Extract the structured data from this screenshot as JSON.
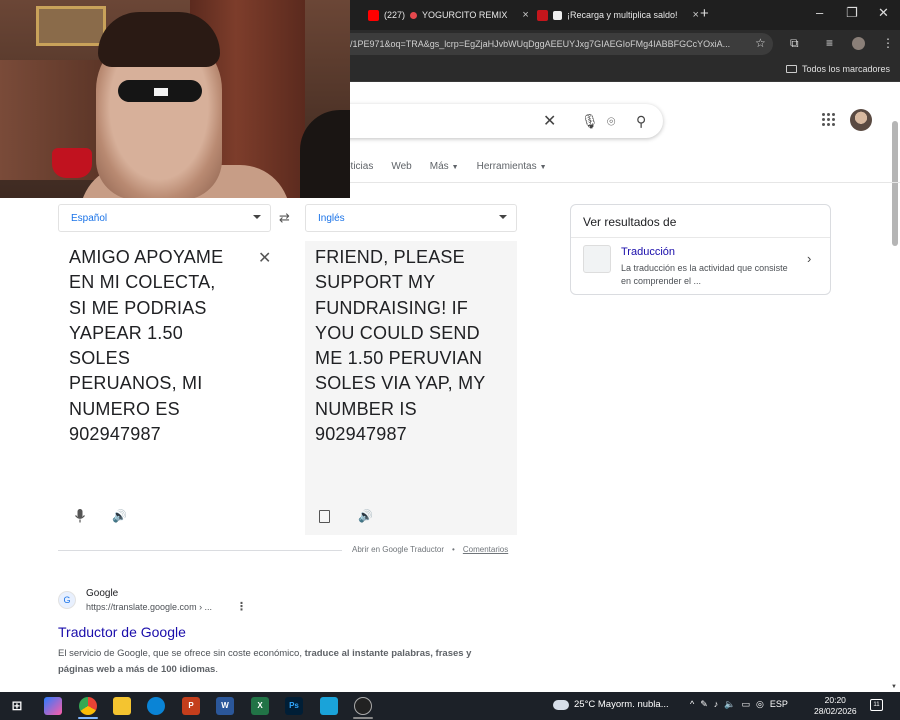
{
  "browser": {
    "tabs": [
      {
        "label": "(227)",
        "extra": "YOGURCITO REMIX",
        "fav_color": "#ff0000"
      },
      {
        "label": "¡Recarga y multiplica saldo!",
        "extra": "",
        "fav_color": "#c4161c"
      }
    ],
    "tab_close": "×",
    "new_tab": "+",
    "window_controls": {
      "minimize": "–",
      "restore": "❐",
      "close": "✕"
    },
    "url": "/1PE971&oq=TRA&gs_lcrp=EgZjaHJvbWUqDggAEEUYJxg7GIAEGIoFMg4IABBFGCcYOxiA...",
    "bookmarks_label": "Todos los marcadores"
  },
  "google": {
    "nav_tabs": [
      "Noticias",
      "Web",
      "Más",
      "Herramientas"
    ],
    "nav_tab_visible": [
      "oticias",
      "Web",
      "Más",
      "Herramientas"
    ]
  },
  "translator": {
    "source_lang": "Español",
    "target_lang": "Inglés",
    "source_text": "AMIGO APOYAME EN MI COLECTA, SI ME PODRIAS YAPEAR 1.50 SOLES PERUANOS, MI NUMERO ES 902947987",
    "source_lines": [
      "AMIGO APOYAME",
      "EN MI COLECTA,",
      "SI ME PODRIAS",
      "YAPEAR 1.50",
      "SOLES",
      "PERUANOS, MI",
      "NUMERO ES",
      "902947987"
    ],
    "target_lines": [
      "FRIEND, PLEASE",
      "SUPPORT MY",
      "FUNDRAISING! IF",
      "YOU COULD SEND",
      "ME 1.50 PERUVIAN",
      "SOLES VIA YAP, MY",
      "NUMBER IS",
      "902947987"
    ],
    "open_in": "Abrir en Google Traductor",
    "separator": "•",
    "feedback": "Comentarios"
  },
  "side_panel": {
    "heading": "Ver resultados de",
    "item_title": "Traducción",
    "item_desc": "La traducción es la actividad que consiste en comprender el ..."
  },
  "result": {
    "site": "Google",
    "url": "https://translate.google.com › ...",
    "title": "Traductor de Google",
    "snippet_plain": "El servicio de Google, que se ofrece sin coste económico, ",
    "snippet_bold": "traduce al instante palabras, frases y páginas web a más de 100 idiomas",
    "snippet_end": "."
  },
  "taskbar": {
    "weather": "25°C  Mayorm. nubla...",
    "lang": "ESP",
    "time": "20:20",
    "date": "28/02/2026",
    "notifications": "11"
  },
  "colors": {
    "link": "#1a0dab",
    "accent": "#1a73e8",
    "taskbar": "#1c2128"
  }
}
